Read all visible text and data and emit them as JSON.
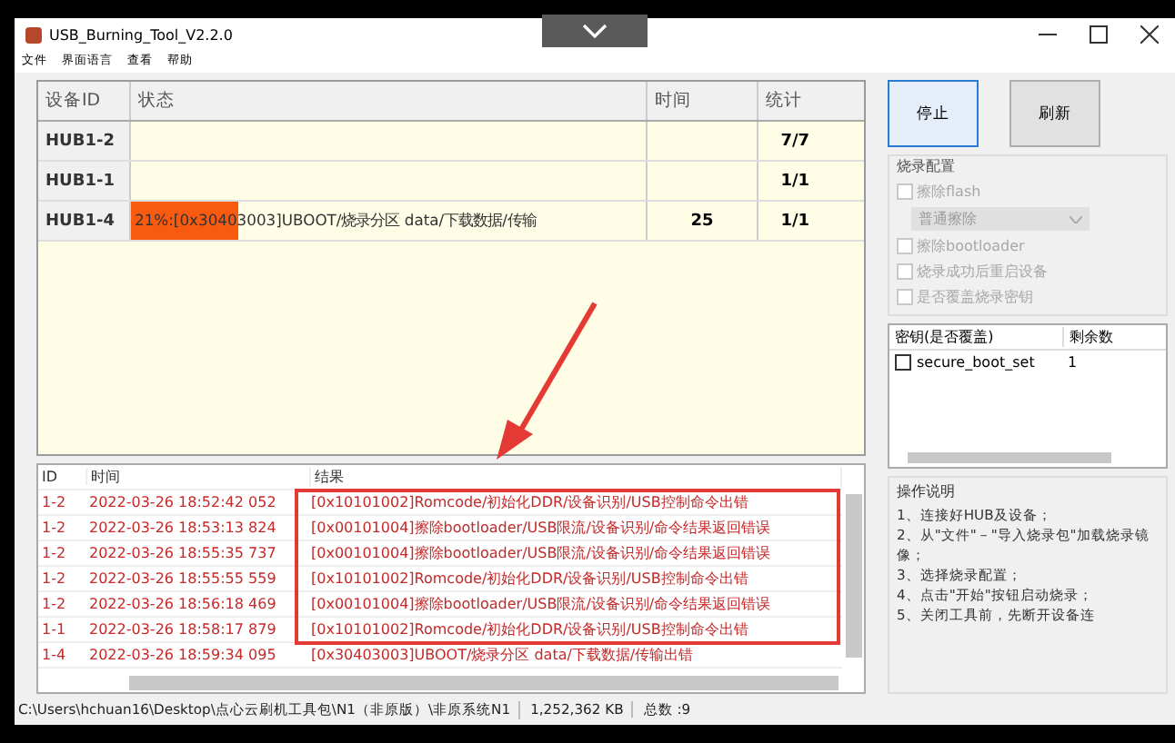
{
  "window": {
    "title": "USB_Burning_Tool_V2.2.0"
  },
  "menu": [
    "文件",
    "界面语言",
    "查看",
    "帮助"
  ],
  "device_table": {
    "columns": [
      "设备ID",
      "状态",
      "时间",
      "统计"
    ],
    "rows": [
      {
        "id": "HUB1-2",
        "status": "",
        "time": "",
        "count": "7/7"
      },
      {
        "id": "HUB1-1",
        "status": "",
        "time": "",
        "count": "1/1"
      },
      {
        "id": "HUB1-4",
        "status": "21%:[0x30403003]UBOOT/烧录分区 data/下载数据/传输",
        "level": 0.21,
        "time": "25",
        "count": "1/1"
      }
    ]
  },
  "log_table": {
    "columns": [
      "ID",
      "时间",
      "结果"
    ],
    "rows": [
      {
        "id": "1-2",
        "time": "2022-03-26 18:52:42 052",
        "result": "[0x10101002]Romcode/初始化DDR/设备识别/USB控制命令出错"
      },
      {
        "id": "1-2",
        "time": "2022-03-26 18:53:13 824",
        "result": "[0x00101004]擦除bootloader/USB限流/设备识别/命令结果返回错误"
      },
      {
        "id": "1-2",
        "time": "2022-03-26 18:55:35 737",
        "result": "[0x00101004]擦除bootloader/USB限流/设备识别/命令结果返回错误"
      },
      {
        "id": "1-2",
        "time": "2022-03-26 18:55:55 559",
        "result": "[0x10101002]Romcode/初始化DDR/设备识别/USB控制命令出错"
      },
      {
        "id": "1-2",
        "time": "2022-03-26 18:56:18 469",
        "result": "[0x00101004]擦除bootloader/USB限流/设备识别/命令结果返回错误"
      },
      {
        "id": "1-1",
        "time": "2022-03-26 18:58:17 879",
        "result": "[0x10101002]Romcode/初始化DDR/设备识别/USB控制命令出错"
      },
      {
        "id": "1-4",
        "time": "2022-03-26 18:59:34 095",
        "result": "[0x30403003]UBOOT/烧录分区 data/下载数据/传输出错"
      }
    ]
  },
  "buttons": [
    {
      "label": "停止",
      "selected": true
    },
    {
      "label": "刷新",
      "selected": false
    }
  ],
  "burn_config": {
    "title": "烧录配置",
    "items": [
      {
        "kind": "checkbox",
        "label": "擦除flash",
        "checked": false,
        "disabled": true
      },
      {
        "kind": "dropdown",
        "label": "普通擦除",
        "disabled": true
      },
      {
        "kind": "checkbox",
        "label": "擦除bootloader",
        "checked": false,
        "disabled": true
      },
      {
        "kind": "checkbox",
        "label": "烧录成功后重启设备",
        "checked": false,
        "disabled": true
      },
      {
        "kind": "checkbox",
        "label": "是否覆盖烧录密钥",
        "checked": false,
        "disabled": true
      }
    ]
  },
  "key_table": {
    "columns": [
      "密钥(是否覆盖)",
      "剩余数"
    ],
    "rows": [
      {
        "name": "secure_boot_set",
        "checked": false,
        "remaining": "1"
      }
    ]
  },
  "instructions": {
    "title": "操作说明",
    "lines": [
      "1、连接好HUB及设备；",
      "2、从\"文件\"－\"导入烧录包\"加载烧录镜像；",
      "3、选择烧录配置；",
      "4、点击\"开始\"按钮启动烧录；",
      "5、关闭工具前，先断开设备连"
    ]
  },
  "status_bar": {
    "path": "C:\\Users\\hchuan16\\Desktop\\点心云刷机工具包\\N1（非原版）\\非原系统N1",
    "size": "1,252,362 KB",
    "total": "总数 :9"
  },
  "annotation": {
    "arrow": true,
    "highlight_box": true
  }
}
